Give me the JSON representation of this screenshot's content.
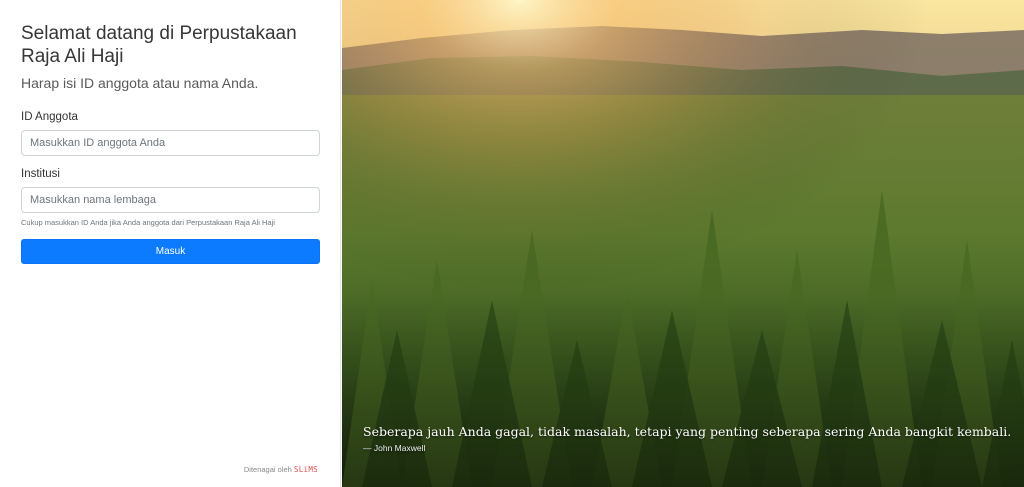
{
  "login": {
    "title": "Selamat datang di Perpustakaan Raja Ali Haji",
    "subtitle": "Harap isi ID anggota atau nama Anda.",
    "member_id_label": "ID Anggota",
    "member_id_placeholder": "Masukkan ID anggota Anda",
    "member_id_value": "",
    "institution_label": "Institusi",
    "institution_placeholder": "Masukkan nama lembaga",
    "institution_value": "",
    "help_text": "Cukup masukkan ID Anda jika Anda anggota dari Perpustakaan Raja Ali Haji",
    "submit_label": "Masuk"
  },
  "footer": {
    "powered_by": "Ditenagai oleh",
    "brand": "SLiMS"
  },
  "hero": {
    "quote": "Seberapa jauh Anda gagal, tidak masalah, tetapi yang penting seberapa sering Anda bangkit kembali.",
    "author": "— John Maxwell"
  },
  "colors": {
    "accent": "#0d7bff",
    "brand": "#d9534f"
  }
}
